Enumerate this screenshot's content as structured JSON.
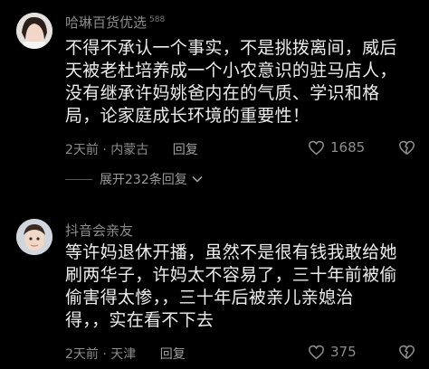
{
  "comments": [
    {
      "username": "哈琳百货优选",
      "level": "588",
      "lines": [
        "不得不承认一个事实，不是挑拨离间，威后",
        "天被老杜培养成一个小农意识的驻马店人，",
        "没有继承许妈姚爸内在的气质、学识和格",
        "局，论家庭成长环境的重要性！"
      ],
      "time": "2天前",
      "location": "内蒙古",
      "reply_label": "回复",
      "likes": "1685"
    },
    {
      "username": "抖音会亲友",
      "level": "",
      "lines": [
        "等许妈退休开播，虽然不是很有钱我敢给她",
        "刷两华子，许妈太不容易了，三十年前被偷",
        "偷害得太惨，，三十年后被亲儿亲媳治",
        "得，，实在看不下去"
      ],
      "time": "2天前",
      "location": "天津",
      "reply_label": "回复",
      "likes": "375"
    }
  ],
  "expand_replies": "展开232条回复",
  "meta_separator": "·",
  "colors": {
    "background": "#000000",
    "text": "#ececec",
    "muted": "#8c8c8c"
  }
}
